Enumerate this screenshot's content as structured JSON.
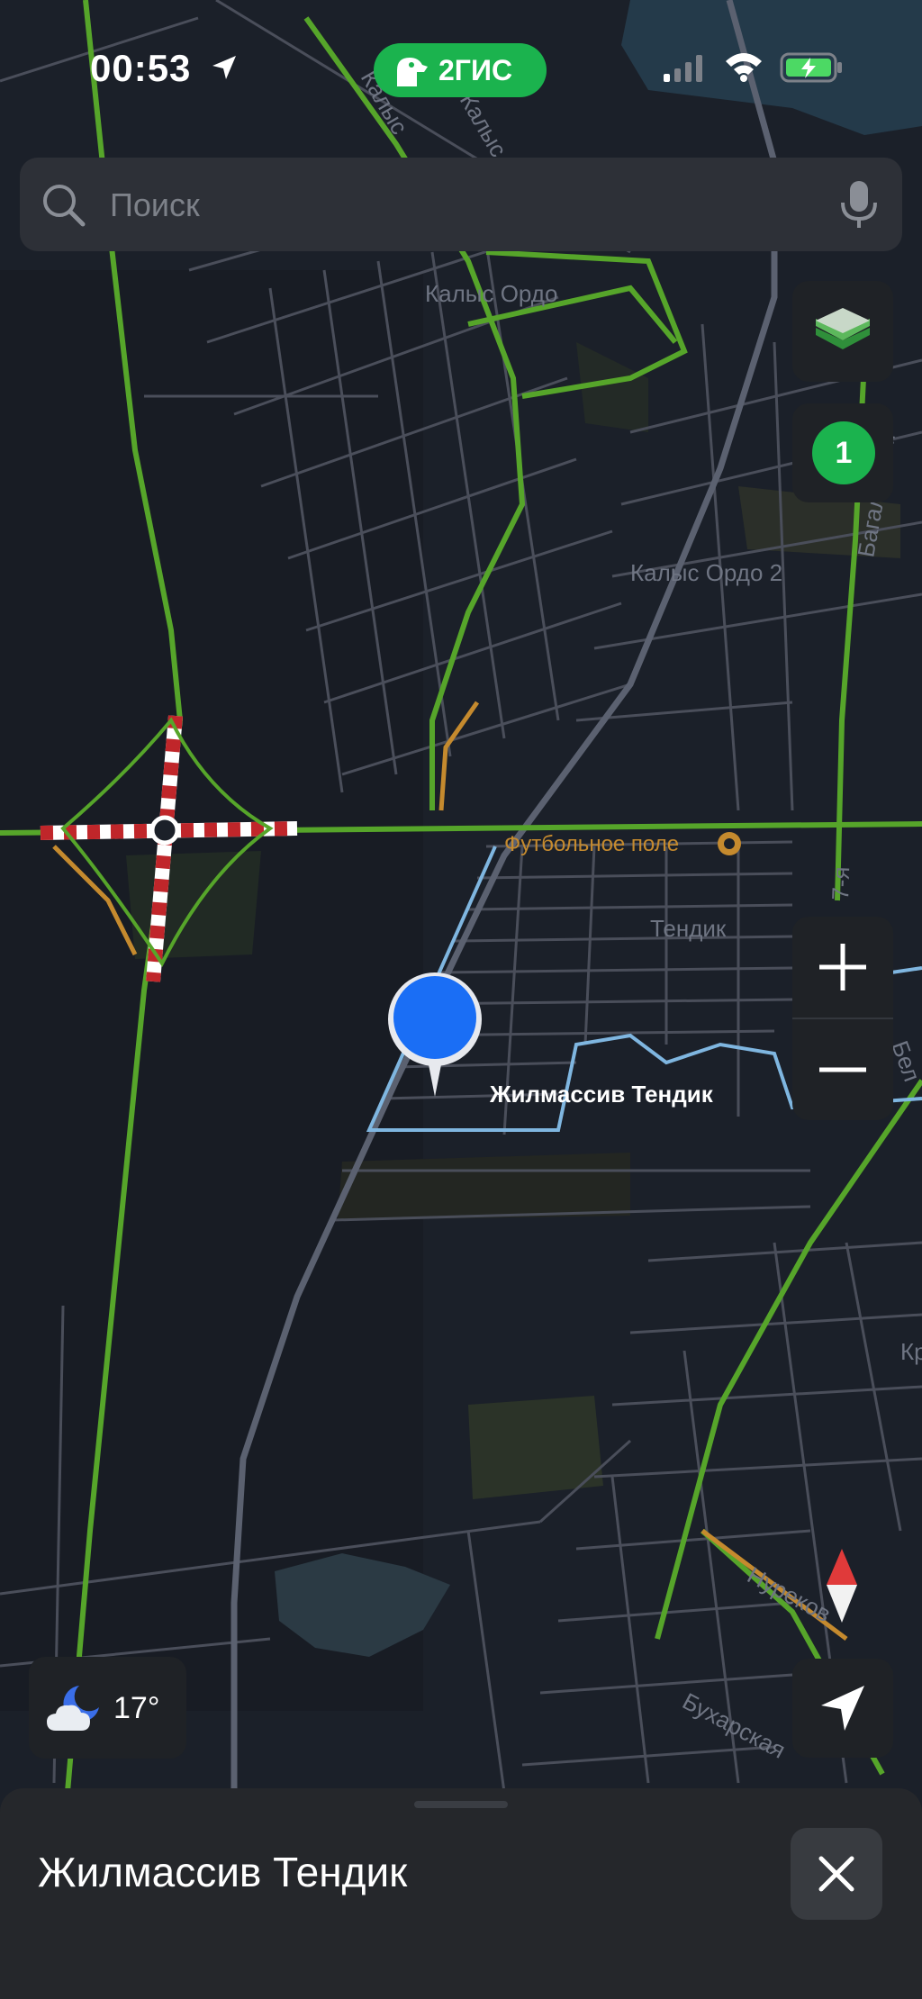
{
  "status_bar": {
    "time": "00:53",
    "brand": "2ГИС"
  },
  "search": {
    "placeholder": "Поиск"
  },
  "map_controls": {
    "counter": "1",
    "zoom_in": "+",
    "zoom_out": "−"
  },
  "map_labels": {
    "kalys_orde": "Калыс Ордо",
    "kalys_orde_2": "Калыс Ордо 2",
    "football": "Футбольное поле",
    "tendik": "Тендик",
    "zhilmassiv": "Жилмассив Тендик",
    "street_kalys_1": "Калыс",
    "street_kalys_2": "Калыс",
    "street_bagalymaman": "Багалымам",
    "street_nureks": "Нуреков",
    "street_buhar": "Бухарская",
    "street_bel": "Бел",
    "street_kr": "Кр",
    "street_7ya": "7-я"
  },
  "weather": {
    "temperature": "17°",
    "icon": "moon-cloud-icon"
  },
  "bottom_sheet": {
    "title": "Жилмассив Тендик"
  },
  "colors": {
    "background": "#1b2029",
    "road": "#4a4e5a",
    "traffic_green": "#56a52a",
    "accent_green": "#1bb34e",
    "pin_blue": "#1a6ef5",
    "boundary": "#7fb6e0"
  }
}
